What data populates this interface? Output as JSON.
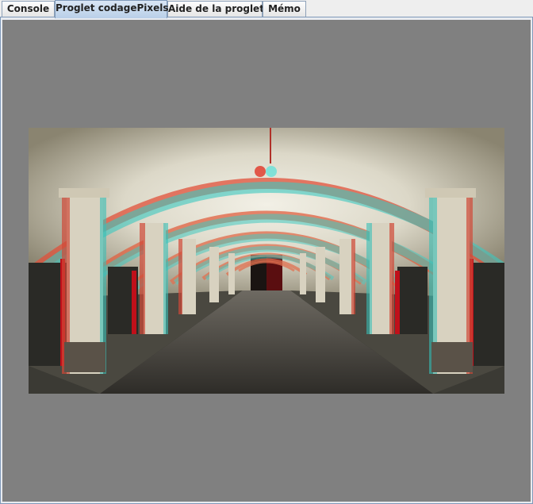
{
  "tabs": [
    {
      "label": "Console",
      "active": false
    },
    {
      "label": "Proglet codagePixels",
      "active": true
    },
    {
      "label": "Aide de la proglet",
      "active": false
    },
    {
      "label": "Mémo",
      "active": false
    }
  ],
  "canvas": {
    "background_color": "#808080",
    "image": "anaglyph-arcade-corridor"
  }
}
